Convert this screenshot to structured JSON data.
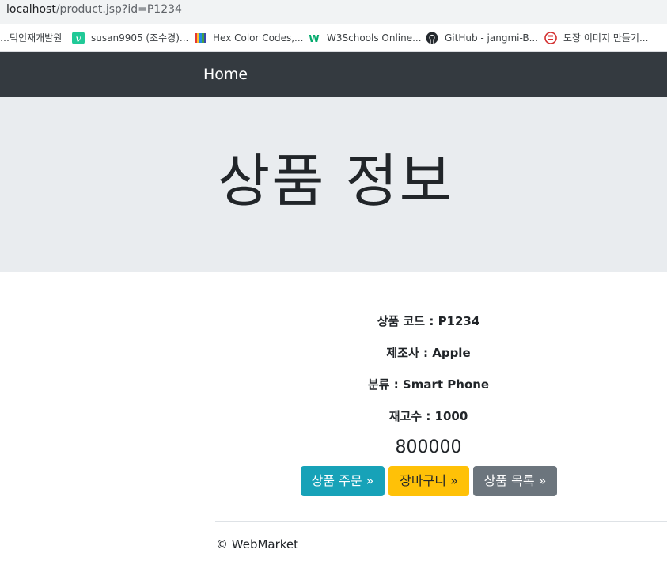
{
  "browser": {
    "address": {
      "host": "localhost",
      "path": "/product.jsp?id=P1234"
    },
    "bookmarks": [
      {
        "label": "…덕인재개발원",
        "icon": "bookmark-icon"
      },
      {
        "label": "susan9905 (조수경)...",
        "icon": "velog-icon"
      },
      {
        "label": "Hex Color Codes,...",
        "icon": "color-book-icon"
      },
      {
        "label": "W3Schools Online...",
        "icon": "w3schools-icon"
      },
      {
        "label": "GitHub - jangmi-B...",
        "icon": "github-icon"
      },
      {
        "label": "도장 이미지 만들기...",
        "icon": "stamp-icon"
      }
    ]
  },
  "navbar": {
    "home_label": "Home",
    "background": "#343a40"
  },
  "jumbotron": {
    "title": "상품 정보"
  },
  "product": {
    "code_label": "상품 코드 : ",
    "code": "P1234",
    "manufacturer_label": "제조사 : ",
    "manufacturer": "Apple",
    "category_label": "분류 : ",
    "category": "Smart Phone",
    "stock_label": "재고수 : ",
    "stock": "1000",
    "price": "800000"
  },
  "buttons": {
    "order": "상품 주문 »",
    "cart": "장바구니 »",
    "list": "상품 목록 »"
  },
  "colors": {
    "order": "#17a2b8",
    "cart": "#ffc107",
    "list": "#6c757d"
  },
  "footer": {
    "text": "© WebMarket"
  }
}
